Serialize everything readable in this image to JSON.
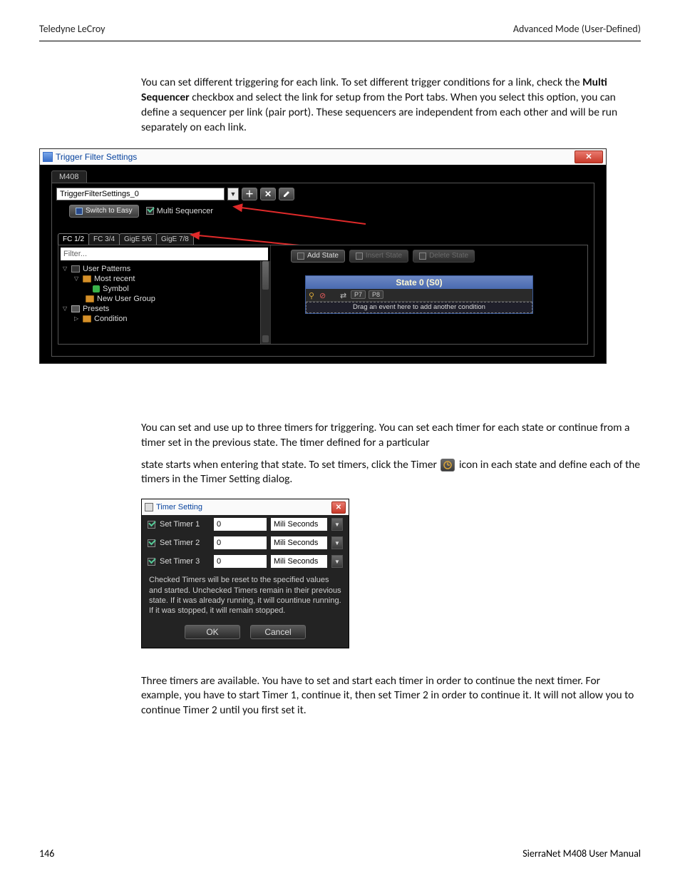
{
  "header": {
    "left": "Teledyne LeCroy",
    "right": "Advanced Mode (User-Defined)"
  },
  "para1_pre": "You can set different triggering for each link. To set different trigger conditions for a link, check the ",
  "para1_bold": "Multi Sequencer",
  "para1_post": " checkbox and select the link for setup from the Port tabs. When you select this option, you can define a sequencer per link (pair port). These sequencers are independent from each other and will be run separately on each link.",
  "tfs": {
    "title": "Trigger Filter Settings",
    "device_tab": "M408",
    "dropdown": "TriggerFilterSettings_0",
    "switch_label": "Switch to Easy",
    "multi_label": "Multi Sequencer",
    "port_tabs": [
      "FC 1/2",
      "FC 3/4",
      "GigE 5/6",
      "GigE 7/8"
    ],
    "filter_placeholder": "Filter...",
    "tree": {
      "user_patterns": "User Patterns",
      "most_recent": "Most recent",
      "symbol": "Symbol",
      "new_user_group": "New User Group",
      "presets": "Presets",
      "condition": "Condition"
    },
    "state_buttons": {
      "add": "Add State",
      "insert": "Insert State",
      "delete": "Delete State"
    },
    "state_header": "State 0 (S0)",
    "ports": {
      "p7": "P7",
      "p8": "P8"
    },
    "drop_text": "Drag an event here to add another condition"
  },
  "para2": "You can set and use up to three timers for triggering. You can set each timer for each state or continue from a timer set in the previous state. The timer defined for a particular",
  "para3_pre": "state starts when entering that state. To set timers, click the Timer ",
  "para3_post": " icon in each state and define each of the timers in the Timer Setting dialog.",
  "timer": {
    "title": "Timer Setting",
    "rows": [
      {
        "label": "Set Timer 1",
        "value": "0",
        "unit": "Mili Seconds"
      },
      {
        "label": "Set Timer 2",
        "value": "0",
        "unit": "Mili Seconds"
      },
      {
        "label": "Set Timer 3",
        "value": "0",
        "unit": "Mili Seconds"
      }
    ],
    "help": "Checked Timers will be reset to the specified values and started.\nUnchecked Timers remain in their previous state. If it was already running, it will countinue running. If it was stopped, it will remain stopped.",
    "ok": "OK",
    "cancel": "Cancel"
  },
  "para4": "Three timers are available. You have to set and start each timer in order to continue the next timer. For example, you have to start Timer 1, continue it, then set Timer 2 in order to continue it. It will not allow you to continue Timer 2 until you first set it.",
  "footer": {
    "page": "146",
    "doc": "SierraNet M408 User Manual"
  }
}
